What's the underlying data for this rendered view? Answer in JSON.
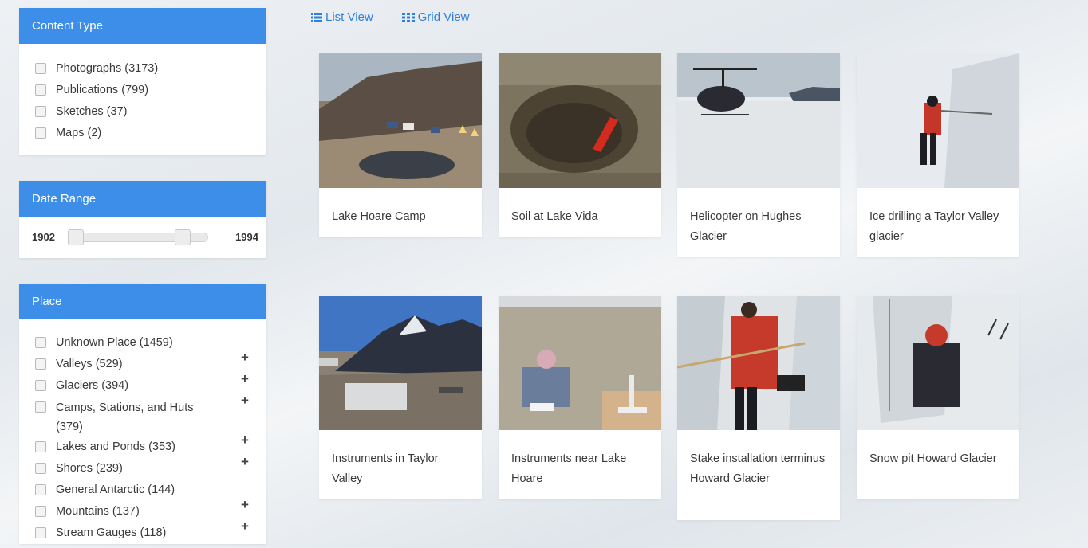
{
  "content_type": {
    "title": "Content Type",
    "items": [
      {
        "label": "Photographs (3173)"
      },
      {
        "label": "Publications (799)"
      },
      {
        "label": "Sketches (37)"
      },
      {
        "label": "Maps (2)"
      }
    ]
  },
  "date_range": {
    "title": "Date Range",
    "min": "1902",
    "max": "1994"
  },
  "place": {
    "title": "Place",
    "items": [
      {
        "label": "Unknown Place (1459)",
        "expandable": false
      },
      {
        "label": "Valleys (529)",
        "expandable": true
      },
      {
        "label": "Glaciers (394)",
        "expandable": true
      },
      {
        "label": "Camps, Stations, and Huts (379)",
        "expandable": true
      },
      {
        "label": "Lakes and Ponds (353)",
        "expandable": true
      },
      {
        "label": "Shores (239)",
        "expandable": true
      },
      {
        "label": "General Antarctic (144)",
        "expandable": false
      },
      {
        "label": "Mountains (137)",
        "expandable": true
      },
      {
        "label": "Stream Gauges (118)",
        "expandable": true
      }
    ],
    "expand_symbol": "+"
  },
  "view": {
    "list_label": "List View",
    "grid_label": "Grid View",
    "list_icon": "list-icon",
    "grid_icon": "grid-icon"
  },
  "results": [
    {
      "title": "Lake Hoare Camp"
    },
    {
      "title": "Soil at Lake Vida"
    },
    {
      "title": "Helicopter on Hughes Glacier"
    },
    {
      "title": "Ice drilling a Taylor Valley glacier"
    },
    {
      "title": "Instruments in Taylor Valley"
    },
    {
      "title": "Instruments near Lake Hoare"
    },
    {
      "title": "Stake installation terminus Howard Glacier"
    },
    {
      "title": "Snow pit Howard Glacier"
    }
  ],
  "colors": {
    "accent": "#3d8ee8",
    "link": "#2f80d8"
  }
}
